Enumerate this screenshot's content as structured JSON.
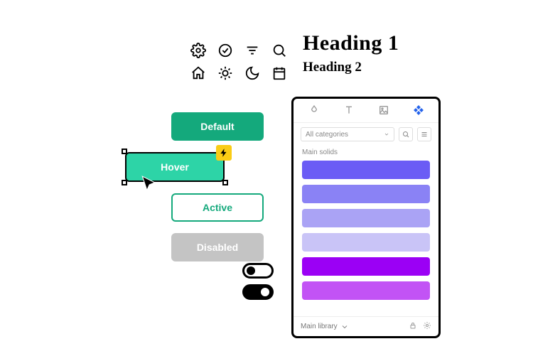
{
  "headings": {
    "h1": "Heading 1",
    "h2": "Heading 2"
  },
  "icons": {
    "row1": [
      "settings",
      "check-circle",
      "filter",
      "search"
    ],
    "row2": [
      "home",
      "sun",
      "moon",
      "calendar"
    ]
  },
  "buttons": {
    "default": "Default",
    "hover": "Hover",
    "active": "Active",
    "disabled": "Disabled"
  },
  "toggles": {
    "toggle1": false,
    "toggle2": true
  },
  "panel": {
    "tabs": [
      "drop",
      "text",
      "image",
      "components"
    ],
    "active_tab": 3,
    "category_label": "All categories",
    "section_label": "Main solids",
    "swatches": [
      "#6b5cf5",
      "#8a82f5",
      "#aaa3f5",
      "#c9c4f7",
      "#9b00f5",
      "#c253f5"
    ],
    "footer_library": "Main library"
  }
}
